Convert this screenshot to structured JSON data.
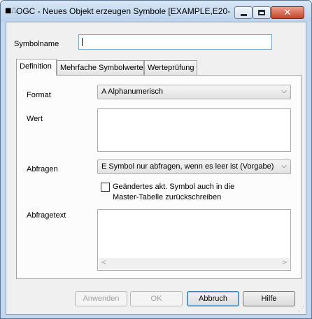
{
  "window": {
    "title": "OGC - Neues Objekt erzeugen Symbole [EXAMPLE,E20-..."
  },
  "form": {
    "symbolname_label": "Symbolname",
    "symbolname_value": ""
  },
  "tabs": [
    {
      "label": "Definition",
      "active": true
    },
    {
      "label": "Mehrfache Symbolwerte",
      "active": false
    },
    {
      "label": "Werteprüfung",
      "active": false
    }
  ],
  "definition": {
    "format_label": "Format",
    "format_value": "A Alphanumerisch",
    "wert_label": "Wert",
    "wert_value": "",
    "abfragen_label": "Abfragen",
    "abfragen_value": "E Symbol nur abfragen, wenn es leer ist (Vorgabe)",
    "checkbox_line1": "Geändertes akt. Symbol auch in die",
    "checkbox_line2": "Master-Tabelle zurückschreiben",
    "checkbox_checked": false,
    "abfragetext_label": "Abfragetext",
    "abfragetext_value": ""
  },
  "buttons": {
    "apply": "Anwenden",
    "ok": "OK",
    "cancel": "Abbruch",
    "help": "Hilfe"
  },
  "colors": {
    "frame": "#c3d8ee",
    "focus_border": "#7fa6cc",
    "close_button": "#c7442b"
  }
}
